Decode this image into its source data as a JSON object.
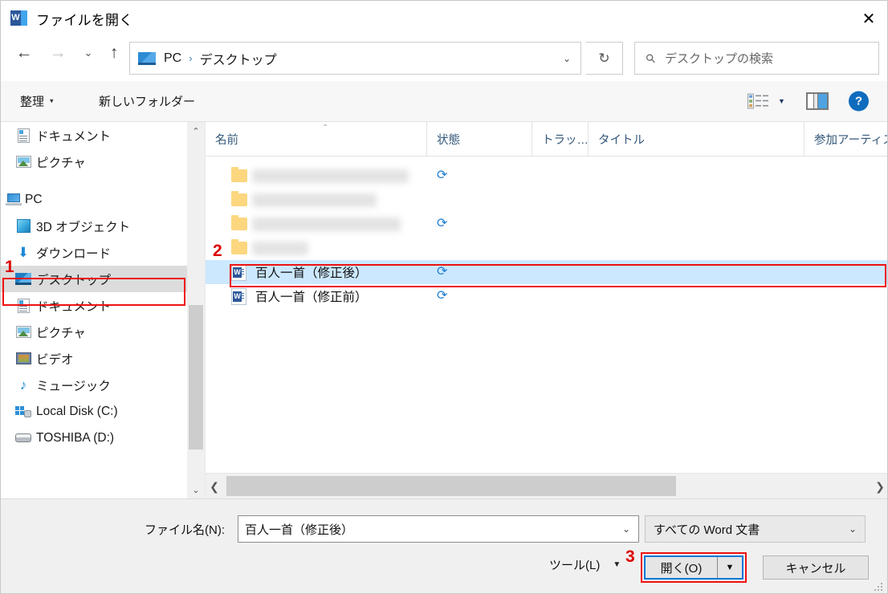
{
  "window": {
    "title": "ファイルを開く",
    "app_icon": "word-icon",
    "app_icon_letter": "W",
    "close_label": "✕"
  },
  "nav": {
    "back_icon": "←",
    "forward_icon": "→",
    "recent_icon": "⌄",
    "up_icon": "↑",
    "refresh_icon": "↻",
    "breadcrumb": [
      "PC",
      "デスクトップ"
    ],
    "breadcrumb_separator": "›",
    "dropdown_caret": "⌄"
  },
  "search": {
    "placeholder": "デスクトップの検索",
    "icon": "search-icon"
  },
  "toolbar": {
    "organize_label": "整理",
    "organize_caret": "▾",
    "new_folder_label": "新しいフォルダー",
    "view_icon": "details-view-icon",
    "view_caret": "▼",
    "preview_icon": "preview-pane-icon",
    "help_label": "?"
  },
  "sidebar": {
    "items": [
      {
        "label": "ドキュメント",
        "icon": "document-icon",
        "level": "child",
        "selected": false
      },
      {
        "label": "ピクチャ",
        "icon": "pictures-icon",
        "level": "child",
        "selected": false
      },
      {
        "label": "PC",
        "icon": "pc-icon",
        "level": "root",
        "selected": false
      },
      {
        "label": "3D オブジェクト",
        "icon": "3d-objects-icon",
        "level": "child",
        "selected": false
      },
      {
        "label": "ダウンロード",
        "icon": "downloads-icon",
        "level": "child",
        "selected": false
      },
      {
        "label": "デスクトップ",
        "icon": "desktop-icon",
        "level": "child",
        "selected": true
      },
      {
        "label": "ドキュメント",
        "icon": "document-icon",
        "level": "child",
        "selected": false
      },
      {
        "label": "ピクチャ",
        "icon": "pictures-icon",
        "level": "child",
        "selected": false
      },
      {
        "label": "ビデオ",
        "icon": "videos-icon",
        "level": "child",
        "selected": false
      },
      {
        "label": "ミュージック",
        "icon": "music-icon",
        "level": "child",
        "selected": false
      },
      {
        "label": "Local Disk (C:)",
        "icon": "local-disk-icon",
        "level": "child",
        "selected": false
      },
      {
        "label": "TOSHIBA (D:)",
        "icon": "removable-drive-icon",
        "level": "child",
        "selected": false
      }
    ],
    "scroll_up_icon": "⌃",
    "scroll_down_icon": "⌄"
  },
  "filelist": {
    "columns": [
      {
        "label": "名前",
        "sorted": true,
        "sort_icon": "⌃"
      },
      {
        "label": "状態",
        "sorted": false
      },
      {
        "label": "トラッ…",
        "sorted": false
      },
      {
        "label": "タイトル",
        "sorted": false
      },
      {
        "label": "参加アーティス",
        "sorted": false
      }
    ],
    "rows": [
      {
        "type": "folder",
        "name": "",
        "redacted": true,
        "redacted_width": 195,
        "sync": true,
        "selected": false
      },
      {
        "type": "folder",
        "name": "",
        "redacted": true,
        "redacted_width": 155,
        "sync": false,
        "selected": false
      },
      {
        "type": "folder",
        "name": "",
        "redacted": true,
        "redacted_width": 185,
        "sync": true,
        "selected": false
      },
      {
        "type": "folder",
        "name": "",
        "redacted": true,
        "redacted_width": 70,
        "sync": false,
        "selected": false
      },
      {
        "type": "word",
        "name": "百人一首（修正後）",
        "redacted": false,
        "sync": true,
        "selected": true
      },
      {
        "type": "word",
        "name": "百人一首（修正前）",
        "redacted": false,
        "sync": true,
        "selected": false
      }
    ],
    "sync_icon": "⟳",
    "hscroll_left_icon": "❮",
    "hscroll_right_icon": "❯"
  },
  "footer": {
    "filename_label": "ファイル名(N):",
    "filename_value": "百人一首（修正後）",
    "filename_caret": "⌄",
    "filter_value": "すべての Word 文書",
    "filter_caret": "⌄",
    "tools_label": "ツール(L)",
    "tools_caret": "▼",
    "open_label": "開く(O)",
    "open_split_caret": "▼",
    "cancel_label": "キャンセル"
  },
  "annotations": [
    {
      "number": "1",
      "target": "sidebar-item-desktop"
    },
    {
      "number": "2",
      "target": "file-row-selected"
    },
    {
      "number": "3",
      "target": "open-button"
    }
  ],
  "colors": {
    "accent": "#0078d7",
    "selection": "#cce8ff",
    "annotation_red": "#ee1111",
    "sync_blue": "#1f7fd0",
    "word_blue": "#2b579a"
  }
}
